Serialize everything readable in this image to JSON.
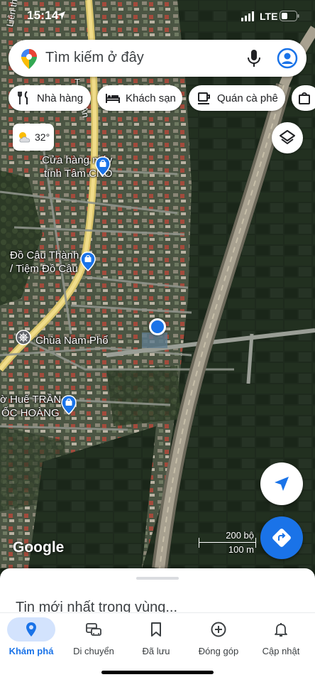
{
  "status_bar": {
    "time": "15:14",
    "network": "LTE"
  },
  "search": {
    "placeholder": "Tìm kiếm ở đây"
  },
  "chips": [
    {
      "label": "Nhà hàng",
      "icon": "restaurant-icon"
    },
    {
      "label": "Khách sạn",
      "icon": "hotel-icon"
    },
    {
      "label": "Quán cà phê",
      "icon": "cafe-icon"
    },
    {
      "label": "",
      "icon": "shopping-bag-icon"
    }
  ],
  "weather": {
    "temperature": "32°",
    "icon": "partly-cloudy-icon"
  },
  "map": {
    "places": [
      {
        "name_line1": "Cửa hàng máy",
        "name_line2": "tính Tâm CNO",
        "icon": "shopping-bag-pin-icon"
      },
      {
        "name_line1": "Đồ Câu Thành",
        "name_line2": "/ Tiệm Đồ Câu",
        "icon": "shopping-bag-pin-icon"
      },
      {
        "name_line1": "Chùa Nam Phổ",
        "name_line2": "",
        "icon": "temple-pin-icon"
      },
      {
        "name_line1": "ờ Huế TRẦN",
        "name_line2": "ỐC HOÀNG",
        "icon": "shopping-bag-pin-icon"
      }
    ],
    "road_labels": [
      "Liên thôn",
      "T",
      "An"
    ],
    "scale": {
      "imperial": "200 bộ",
      "metric": "100 m"
    },
    "logo": "Google"
  },
  "sheet": {
    "title": "Tin mới nhất trong vùng..."
  },
  "nav": [
    {
      "label": "Khám phá",
      "icon": "explore-pin-icon",
      "active": true
    },
    {
      "label": "Di chuyển",
      "icon": "commute-icon",
      "active": false
    },
    {
      "label": "Đã lưu",
      "icon": "bookmark-icon",
      "active": false
    },
    {
      "label": "Đóng góp",
      "icon": "add-circle-icon",
      "active": false
    },
    {
      "label": "Cập nhật",
      "icon": "bell-icon",
      "active": false
    }
  ],
  "colors": {
    "accent": "#1a73e8",
    "active_nav_bg": "#d3e3fd",
    "road": "#e8d48a"
  }
}
